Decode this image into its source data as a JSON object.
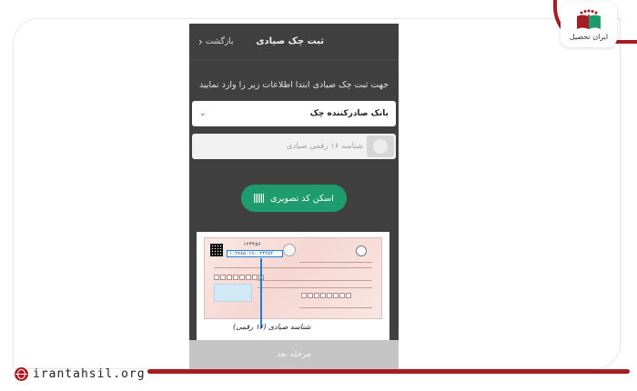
{
  "branding": {
    "logo_text": "ایران تحصیل",
    "site_url": "irantahsil.org",
    "accent_color": "#a61c24"
  },
  "header": {
    "title": "ثبت چک صیادی",
    "back_label": "بازگشت"
  },
  "form": {
    "instruction": "جهت ثبت چک صیادی ابتدا اطلاعات زیر را وارد نمایید",
    "bank_select_label": "بانک صادرکننده چک",
    "id_placeholder": "شناسه ۱۶ رقمی صیادی",
    "scan_button_label": "اسکن کد تصویری",
    "scan_button_color": "#1f9c6f",
    "next_button_label": "مرحله بعد"
  },
  "cheque_illustration": {
    "serial_number": "۱۲۳۴۵۶",
    "id_number": "۱۰۲۷۸۵۰۱۹۰۰۲۳۴۵۴",
    "caption": "شناسه صیادی (۱۶ رقمی)"
  }
}
